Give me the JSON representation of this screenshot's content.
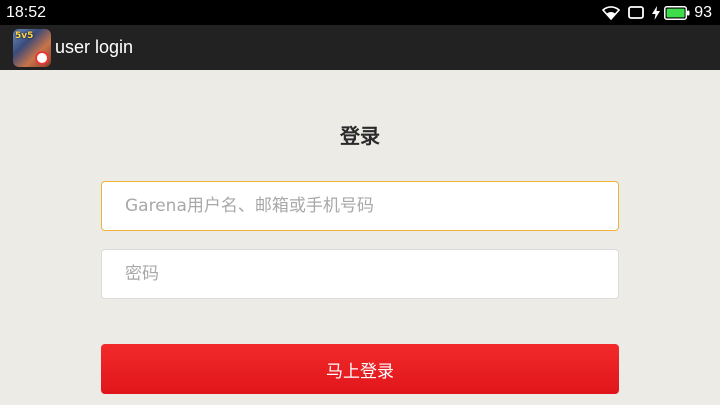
{
  "status_bar": {
    "time": "18:52",
    "battery_level": "93",
    "icons": [
      "wifi-icon",
      "screen-icon",
      "charging-icon",
      "battery-icon"
    ]
  },
  "app_bar": {
    "title": "user login",
    "app_icon_text": "5v5"
  },
  "login": {
    "heading": "登录",
    "username_placeholder": "Garena用户名、邮箱或手机号码",
    "password_placeholder": "密码",
    "submit_label": "马上登录"
  },
  "colors": {
    "accent_red": "#e8191e",
    "focus_border": "#f0b43c",
    "background": "#ecebe6"
  }
}
